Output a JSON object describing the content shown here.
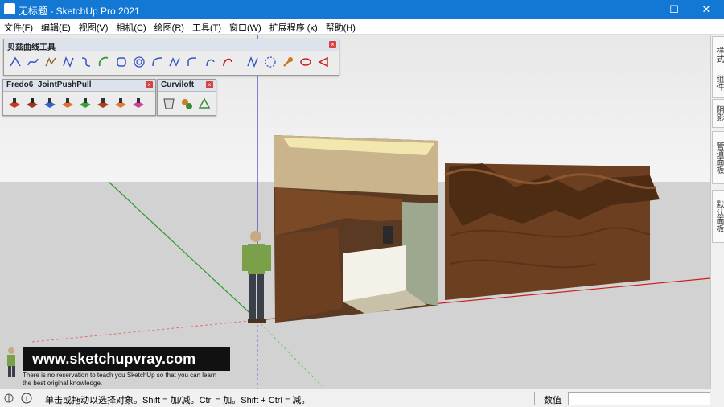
{
  "window": {
    "title": "无标题 - SketchUp Pro 2021",
    "controls": [
      "—",
      "☐",
      "✕"
    ]
  },
  "menu": [
    "文件(F)",
    "编辑(E)",
    "视图(V)",
    "相机(C)",
    "绘图(R)",
    "工具(T)",
    "窗口(W)",
    "扩展程序 (x)",
    "帮助(H)"
  ],
  "toolbars": {
    "bezier": {
      "title": "贝兹曲线工具",
      "close": "×"
    },
    "pushpull": {
      "title": "Fredo6_JointPushPull",
      "close": "×"
    },
    "curviloft": {
      "title": "Curviloft",
      "close": "×"
    }
  },
  "right_panel_tabs": [
    "样式",
    "组件",
    "阴影",
    "管道面板",
    "默认面板"
  ],
  "statusbar": {
    "hint": "单击或拖动以选择对象。Shift = 加/减。Ctrl = 加。Shift + Ctrl = 减。",
    "value_label": "数值",
    "value": ""
  },
  "watermark": {
    "url": "www.sketchupvray.com",
    "line1": "There is no reservation to teach you SketchUp so that you can learn",
    "line2": "the best original knowledge."
  },
  "colors": {
    "titlebar": "#1378d4",
    "axis_red": "#c8201e",
    "axis_green": "#2a9a2a",
    "axis_blue": "#3a3ab8",
    "wood": "#6b3f1f"
  }
}
